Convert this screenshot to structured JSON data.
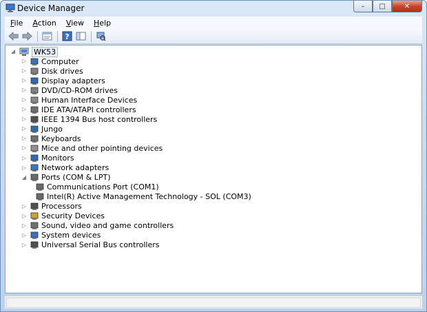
{
  "window": {
    "title": "Device Manager"
  },
  "controls": {
    "minimize": "–",
    "maximize": "□",
    "close": "✕"
  },
  "menu": [
    {
      "prefix": "",
      "ul": "F",
      "rest": "ile"
    },
    {
      "prefix": "",
      "ul": "A",
      "rest": "ction"
    },
    {
      "prefix": "",
      "ul": "V",
      "rest": "iew"
    },
    {
      "prefix": "",
      "ul": "H",
      "rest": "elp"
    }
  ],
  "toolbar": {
    "buttons": [
      "back-icon",
      "forward-icon",
      "properties-icon",
      "help-icon",
      "show-hide-icon",
      "scan-hardware-icon"
    ]
  },
  "tree": {
    "root": "WK53",
    "categories": [
      {
        "label": "Computer",
        "icon": "computer-icon",
        "color": "#3a6fc2"
      },
      {
        "label": "Disk drives",
        "icon": "disk-drive-icon",
        "color": "#808080"
      },
      {
        "label": "Display adapters",
        "icon": "display-adapter-icon",
        "color": "#2d6bb8"
      },
      {
        "label": "DVD/CD-ROM drives",
        "icon": "dvd-drive-icon",
        "color": "#808080"
      },
      {
        "label": "Human Interface Devices",
        "icon": "hid-icon",
        "color": "#8a8a8a"
      },
      {
        "label": "IDE ATA/ATAPI controllers",
        "icon": "ide-controller-icon",
        "color": "#707070"
      },
      {
        "label": "IEEE 1394 Bus host controllers",
        "icon": "firewire-icon",
        "color": "#505050"
      },
      {
        "label": "Jungo",
        "icon": "jungo-icon",
        "color": "#2e6db0"
      },
      {
        "label": "Keyboards",
        "icon": "keyboard-icon",
        "color": "#707070"
      },
      {
        "label": "Mice and other pointing devices",
        "icon": "mouse-icon",
        "color": "#909090"
      },
      {
        "label": "Monitors",
        "icon": "monitor-icon",
        "color": "#2d6bb8"
      },
      {
        "label": "Network adapters",
        "icon": "network-adapter-icon",
        "color": "#3a78c0"
      },
      {
        "label": "Ports (COM & LPT)",
        "icon": "port-icon",
        "color": "#6a6a6a",
        "expanded": true
      },
      {
        "label": "Communications Port (COM1)",
        "icon": "port-icon",
        "color": "#6a6a6a",
        "child": true
      },
      {
        "label": "Intel(R) Active Management Technology - SOL (COM3)",
        "icon": "port-icon",
        "color": "#6a6a6a",
        "child": true
      },
      {
        "label": "Processors",
        "icon": "processor-icon",
        "color": "#505050"
      },
      {
        "label": "Security Devices",
        "icon": "security-device-icon",
        "color": "#c9a23a"
      },
      {
        "label": "Sound, video and game controllers",
        "icon": "sound-icon",
        "color": "#707070"
      },
      {
        "label": "System devices",
        "icon": "system-device-icon",
        "color": "#3a6fc2"
      },
      {
        "label": "Universal Serial Bus controllers",
        "icon": "usb-icon",
        "color": "#505050"
      }
    ]
  }
}
